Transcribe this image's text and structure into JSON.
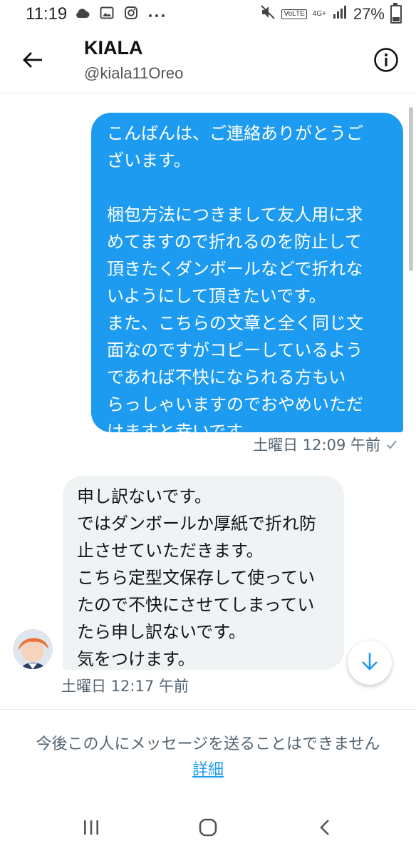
{
  "status_bar": {
    "time": "11:19",
    "battery": "27%",
    "battery_level": 0.27,
    "network": "4G+",
    "volte": "VoLTE",
    "left_icons": [
      "cloud-icon",
      "image-icon",
      "instagram-icon",
      "more-icon"
    ],
    "right_icons": [
      "mute-icon",
      "signal-icon",
      "battery-icon"
    ]
  },
  "header": {
    "title": "KIALA",
    "handle": "@kiala11Oreo",
    "back_icon": "back-arrow-icon",
    "info_icon": "info-icon"
  },
  "messages": [
    {
      "direction": "sent",
      "text": "こんばんは、ご連絡ありがとうご\nざいます。\n\n梱包方法につきまして友人用に求\nめてますので折れるのを防止して\n頂きたくダンボールなどで折れな\nいようにして頂きたいです。\nまた、こちらの文章と全く同じ文\n面なのですがコピーしているよう\nであれば不快になられる方もい\nらっしゃいますのでおやめいただ\nけますと幸いです。",
      "timestamp": "土曜日 12:09 午前",
      "status_icon": "check-icon",
      "color": "#1d9bf0"
    },
    {
      "direction": "received",
      "text": "申し訳ないです。\nではダンボールか厚紙で折れ防\n止させていただきます。\nこちら定型文保存して使ってい\nたので不快にさせてしまってい\nたら申し訳ないです。\n気をつけます。",
      "timestamp": "土曜日 12:17 午前",
      "color": "#eff3f4"
    }
  ],
  "footer": {
    "notice": "今後この人にメッセージを送ることはできません",
    "link": "詳細"
  },
  "nav": {
    "recent_icon": "recent-apps-icon",
    "home_icon": "home-icon",
    "back_icon": "back-chevron-icon"
  }
}
